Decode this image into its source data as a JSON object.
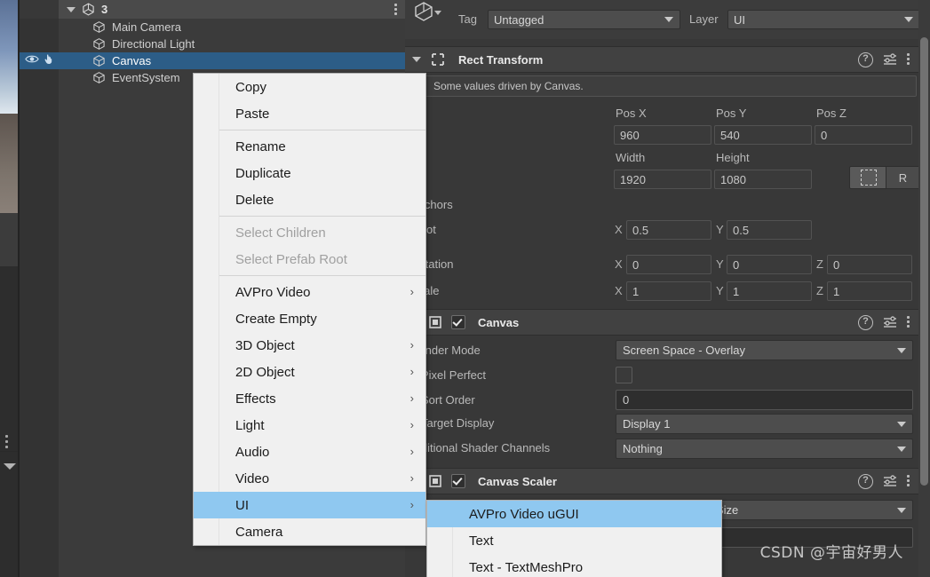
{
  "hierarchy": {
    "scene_name": "3",
    "kebab_icon": "kebab-menu-icon",
    "rows": [
      {
        "label": "Main Camera",
        "icon": "game-object-icon",
        "selected": false,
        "visibility_icon": "",
        "pickability_icon": ""
      },
      {
        "label": "Directional Light",
        "icon": "game-object-icon",
        "selected": false,
        "visibility_icon": "",
        "pickability_icon": ""
      },
      {
        "label": "Canvas",
        "icon": "game-object-icon",
        "selected": true,
        "visibility_icon": "eye-icon",
        "pickability_icon": "hand-pointer-icon"
      },
      {
        "label": "EventSystem",
        "icon": "game-object-icon",
        "selected": false,
        "visibility_icon": "",
        "pickability_icon": ""
      }
    ]
  },
  "inspector": {
    "tag": {
      "label": "Tag",
      "value": "Untagged"
    },
    "layer": {
      "label": "Layer",
      "value": "UI"
    },
    "rect_transform": {
      "title": "Rect Transform",
      "info": "Some values driven by Canvas.",
      "pos_x_label": "Pos X",
      "pos_y_label": "Pos Y",
      "pos_z_label": "Pos Z",
      "pos_x": "960",
      "pos_y": "540",
      "pos_z": "0",
      "width_label": "Width",
      "height_label": "Height",
      "width": "1920",
      "height": "1080",
      "anchor_r_label": "R",
      "anchors_label": "Anchors",
      "pivot_label": "Pivot",
      "pivot_x": "0.5",
      "pivot_y": "0.5",
      "rotation_label": "Rotation",
      "rot_x": "0",
      "rot_y": "0",
      "rot_z": "0",
      "scale_label": "Scale",
      "scale_x": "1",
      "scale_y": "1",
      "scale_z": "1",
      "axis_x": "X",
      "axis_y": "Y",
      "axis_z": "Z"
    },
    "canvas": {
      "title": "Canvas",
      "render_mode_label": "Render Mode",
      "render_mode_value": "Screen Space - Overlay",
      "pixel_perfect_label": "Pixel Perfect",
      "sort_order_label": "Sort Order",
      "sort_order_value": "0",
      "target_display_label": "Target Display",
      "target_display_value": "Display 1",
      "shader_channels_label": "Additional Shader Channels",
      "shader_channels_value": "Nothing"
    },
    "canvas_scaler": {
      "title": "Canvas Scaler",
      "partial_value": "Size"
    }
  },
  "context_menu": {
    "items": [
      {
        "label": "Copy",
        "submenu": false,
        "disabled": false,
        "highlight": false,
        "sep_after": false
      },
      {
        "label": "Paste",
        "submenu": false,
        "disabled": false,
        "highlight": false,
        "sep_after": true
      },
      {
        "label": "Rename",
        "submenu": false,
        "disabled": false,
        "highlight": false,
        "sep_after": false
      },
      {
        "label": "Duplicate",
        "submenu": false,
        "disabled": false,
        "highlight": false,
        "sep_after": false
      },
      {
        "label": "Delete",
        "submenu": false,
        "disabled": false,
        "highlight": false,
        "sep_after": true
      },
      {
        "label": "Select Children",
        "submenu": false,
        "disabled": true,
        "highlight": false,
        "sep_after": false
      },
      {
        "label": "Select Prefab Root",
        "submenu": false,
        "disabled": true,
        "highlight": false,
        "sep_after": true
      },
      {
        "label": "AVPro Video",
        "submenu": true,
        "disabled": false,
        "highlight": false,
        "sep_after": false
      },
      {
        "label": "Create Empty",
        "submenu": false,
        "disabled": false,
        "highlight": false,
        "sep_after": false
      },
      {
        "label": "3D Object",
        "submenu": true,
        "disabled": false,
        "highlight": false,
        "sep_after": false
      },
      {
        "label": "2D Object",
        "submenu": true,
        "disabled": false,
        "highlight": false,
        "sep_after": false
      },
      {
        "label": "Effects",
        "submenu": true,
        "disabled": false,
        "highlight": false,
        "sep_after": false
      },
      {
        "label": "Light",
        "submenu": true,
        "disabled": false,
        "highlight": false,
        "sep_after": false
      },
      {
        "label": "Audio",
        "submenu": true,
        "disabled": false,
        "highlight": false,
        "sep_after": false
      },
      {
        "label": "Video",
        "submenu": true,
        "disabled": false,
        "highlight": false,
        "sep_after": false
      },
      {
        "label": "UI",
        "submenu": true,
        "disabled": false,
        "highlight": true,
        "sep_after": false
      },
      {
        "label": "Camera",
        "submenu": false,
        "disabled": false,
        "highlight": false,
        "sep_after": false
      }
    ],
    "submenu_arrow_glyph": "›"
  },
  "submenu": {
    "items": [
      {
        "label": "AVPro Video uGUI",
        "highlight": true
      },
      {
        "label": "Text",
        "highlight": false
      },
      {
        "label": "Text - TextMeshPro",
        "highlight": false
      }
    ]
  },
  "watermark": {
    "text": "CSDN @宇宙好男人"
  },
  "colors": {
    "selection_blue": "#2c5d87",
    "menu_highlight": "#8fc8f0",
    "panel_bg": "#383838",
    "menu_bg": "#f0f0f0"
  }
}
